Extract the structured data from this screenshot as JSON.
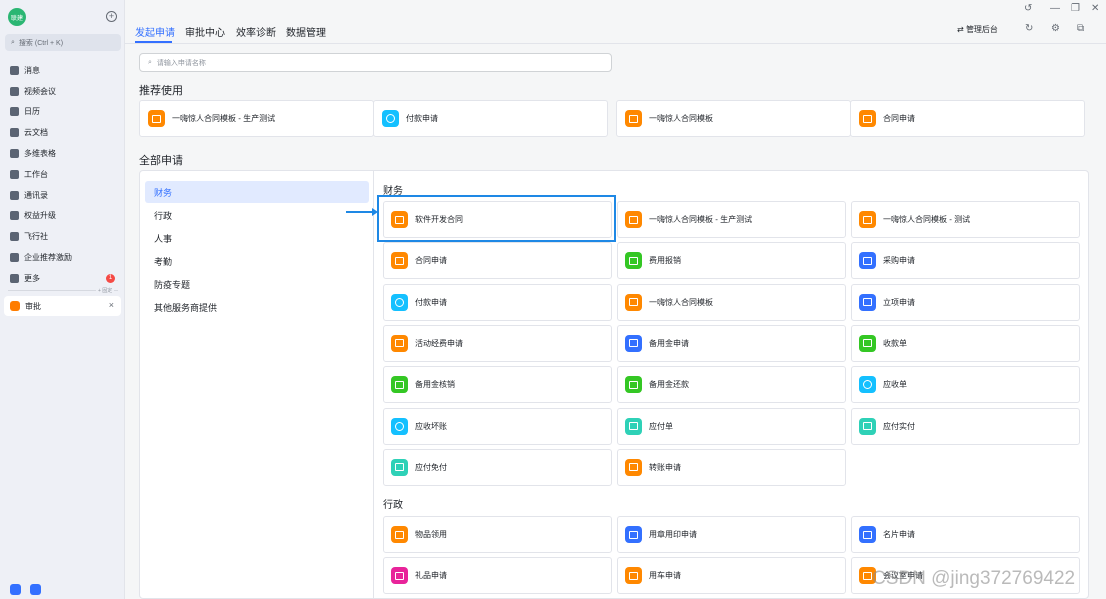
{
  "sidebar": {
    "avatar_text": "联建",
    "search_placeholder": "搜索 (Ctrl + K)",
    "items": [
      {
        "label": "消息",
        "icon": "message-icon"
      },
      {
        "label": "视频会议",
        "icon": "video-icon"
      },
      {
        "label": "日历",
        "icon": "calendar-icon"
      },
      {
        "label": "云文档",
        "icon": "doc-icon"
      },
      {
        "label": "多维表格",
        "icon": "table-icon"
      },
      {
        "label": "工作台",
        "icon": "grid-icon"
      },
      {
        "label": "通讯录",
        "icon": "contacts-icon"
      },
      {
        "label": "权益升级",
        "icon": "diamond-icon"
      },
      {
        "label": "飞行社",
        "icon": "book-icon"
      },
      {
        "label": "企业推荐激励",
        "icon": "people-icon"
      },
      {
        "label": "更多",
        "icon": "more-icon",
        "badge": "1"
      }
    ],
    "pin_label": "+ 固定",
    "pinned": {
      "label": "审批"
    }
  },
  "topbar": {
    "tabs": [
      "发起申请",
      "审批中心",
      "效率诊断",
      "数据管理"
    ],
    "admin_label": "管理后台"
  },
  "main": {
    "search_placeholder": "请输入申请名称",
    "recommended_title": "推荐使用",
    "recommended": [
      {
        "label": "一嗨惊人合同模板 - 生产测试",
        "color": "orange"
      },
      {
        "label": "付款申请",
        "color": "cyan"
      },
      {
        "label": "一嗨惊人合同模板",
        "color": "orange"
      },
      {
        "label": "合同申请",
        "color": "orange"
      }
    ],
    "all_title": "全部申请",
    "categories": [
      "财务",
      "行政",
      "人事",
      "考勤",
      "防疫专题",
      "其他服务商提供"
    ],
    "finance_title": "财务",
    "finance_forms": [
      {
        "label": "软件开发合同",
        "color": "orange"
      },
      {
        "label": "一嗨惊人合同模板 - 生产测试",
        "color": "orange"
      },
      {
        "label": "一嗨惊人合同模板 - 测试",
        "color": "orange"
      },
      {
        "label": "合同申请",
        "color": "orange"
      },
      {
        "label": "费用报销",
        "color": "green"
      },
      {
        "label": "采购申请",
        "color": "blue"
      },
      {
        "label": "付款申请",
        "color": "cyan"
      },
      {
        "label": "一嗨惊人合同模板",
        "color": "orange"
      },
      {
        "label": "立项申请",
        "color": "blue"
      },
      {
        "label": "活动经费申请",
        "color": "orange"
      },
      {
        "label": "备用金申请",
        "color": "blue"
      },
      {
        "label": "收款单",
        "color": "green"
      },
      {
        "label": "备用金核销",
        "color": "green"
      },
      {
        "label": "备用金还款",
        "color": "green"
      },
      {
        "label": "应收单",
        "color": "cyan"
      },
      {
        "label": "应收坏账",
        "color": "cyan"
      },
      {
        "label": "应付单",
        "color": "teal"
      },
      {
        "label": "应付实付",
        "color": "teal"
      },
      {
        "label": "应付免付",
        "color": "teal"
      },
      {
        "label": "转账申请",
        "color": "orange"
      }
    ],
    "admin_title": "行政",
    "admin_forms": [
      {
        "label": "物品领用",
        "color": "orange"
      },
      {
        "label": "用章用印申请",
        "color": "blue"
      },
      {
        "label": "名片申请",
        "color": "blue"
      },
      {
        "label": "礼品申请",
        "color": "pink"
      },
      {
        "label": "用车申请",
        "color": "orange"
      },
      {
        "label": "会议室申请",
        "color": "orange"
      }
    ]
  },
  "watermark": "CSDN @jing372769422"
}
